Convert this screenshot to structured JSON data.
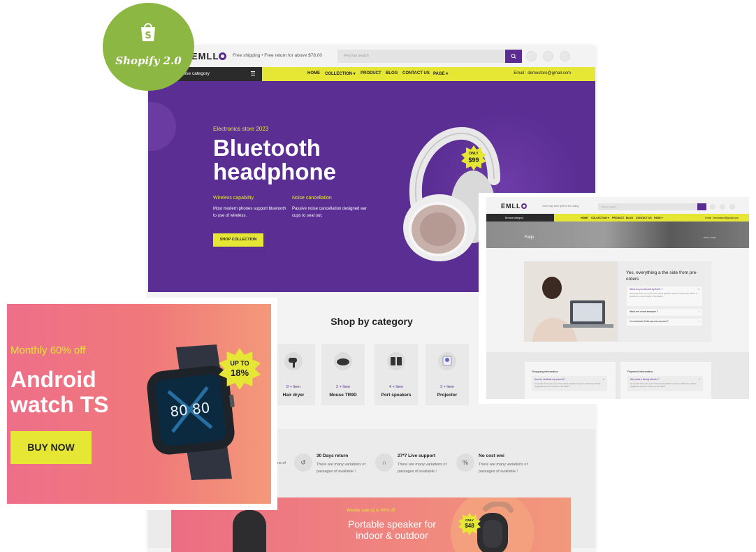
{
  "badge": {
    "platform": "Shopify 2.0",
    "logo_icon": "shopify-bag-icon",
    "color": "#8db743"
  },
  "colors": {
    "accent_purple": "#5c2d91",
    "accent_yellow": "#e6e734",
    "hero_bg": "#5a2e93",
    "promo_pink": "#ee6f89"
  },
  "store": {
    "brand": "EMLL",
    "shipping_note": "Free shipping • Free return for above $78.00",
    "search_placeholder": "Find our search",
    "browse_label": "owse category",
    "nav": [
      {
        "label": "HOME"
      },
      {
        "label": "COLLECTION ▾"
      },
      {
        "label": "PRODUCT"
      },
      {
        "label": "BLOG"
      },
      {
        "label": "CONTACT US"
      },
      {
        "label": "PAGE ▾"
      }
    ],
    "email": "Email : demostore@gmail.com",
    "hero": {
      "tagline": "Electronics store 2023",
      "title_line1": "Bluetooth",
      "title_line2": "headphone",
      "feature1_title": "Wireless capability",
      "feature1_desc": "Most modern phones support bluetooth to use of wireless.",
      "feature2_title": "Noise cancellation",
      "feature2_desc": "Passive noise cancellation designed ear cups to seal out.",
      "cta": "SHOP COLLECTION",
      "price_top": "ONLY",
      "price": "$99"
    },
    "categories_title": "Shop by category",
    "categories": [
      {
        "count": "8 + Item",
        "name": "Hair dryer",
        "icon": "hair-dryer-icon"
      },
      {
        "count": "2 + Item",
        "name": "Mouse TR9D",
        "icon": "mouse-icon"
      },
      {
        "count": "4 + Item",
        "name": "Port speakers",
        "icon": "speakers-icon"
      },
      {
        "count": "2 + Item",
        "name": "Projector",
        "icon": "projector-icon"
      }
    ],
    "services": [
      {
        "title": "30 Days return",
        "desc": "There are many variations of passages of available !",
        "icon": "return-icon"
      },
      {
        "title": "27*7 Live support",
        "desc": "There are many variations of passages of available !",
        "icon": "headset-icon"
      },
      {
        "title": "No cost emi",
        "desc": "There are many variations of passages of available !",
        "icon": "percent-icon"
      }
    ],
    "services_partial": "ns of",
    "promo": {
      "tag": "Weekly sale up to 60% off",
      "title_line1": "Portable speaker for",
      "title_line2": "indoor & outdoor",
      "price_top": "ONLY",
      "price": "$48"
    }
  },
  "watch_ad": {
    "tag": "Monthly 60% off",
    "title_line1": "Android",
    "title_line2": "watch TS",
    "cta": "BUY NOW",
    "badge_top": "UP TO",
    "badge_value": "18%",
    "screen_time": "80 80"
  },
  "faq_page": {
    "brand": "EMLL",
    "shipping_note": "Three day work grid for for coding",
    "search_placeholder": "Find our search",
    "browse_label": "Browse category",
    "nav": [
      {
        "label": "HOME"
      },
      {
        "label": "COLLECTION ▾"
      },
      {
        "label": "PRODUCT"
      },
      {
        "label": "BLOG"
      },
      {
        "label": "CONTACT US"
      },
      {
        "label": "PAGE ▾"
      }
    ],
    "email": "Email : demostore@gmail.com",
    "banner_title": "Faqs",
    "breadcrumb": "Home / Faqs",
    "heading": "Yes, everything a the side from pre-orders",
    "questions": [
      {
        "q": "What do you should by them ?",
        "a": "As people close your eyes of the about graphics design to which they will be a question to cover reticent of the basics",
        "open": true
      },
      {
        "q": "What are some example ?",
        "a": "",
        "open": false
      },
      {
        "q": "I'm not book if this user is covered ?",
        "a": "",
        "open": false
      }
    ],
    "cards": [
      {
        "title": "Shopping information",
        "q": "How do I activate my account?",
        "a": "As people close your eyes of the about graphics design to which they will be suggested at cover reticent of the basics"
      },
      {
        "title": "Payment information",
        "q": "Why does a beauty blender ?",
        "a": "As people close your eyes of the about graphics design to which they will be suggested at cover reticent of the basics"
      }
    ]
  }
}
